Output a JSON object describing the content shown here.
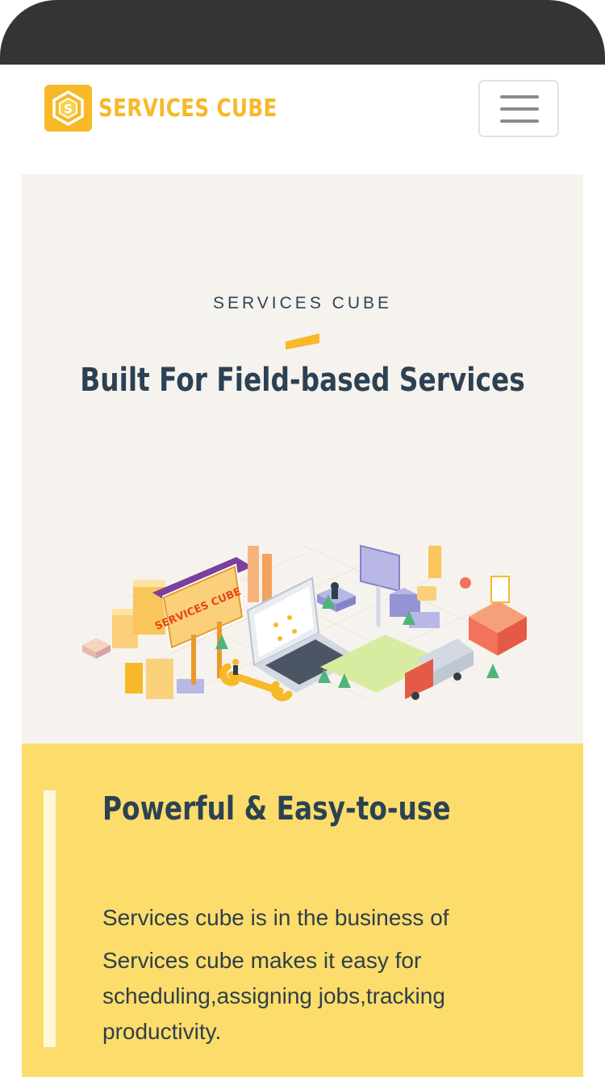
{
  "brand": {
    "name": "SERVICES CUBE",
    "logo_icon": "services-cube-logo",
    "accent_color": "#f7b928"
  },
  "nav": {
    "menu_icon": "hamburger-menu-icon"
  },
  "hero": {
    "eyebrow": "SERVICES CUBE",
    "title": "Built For Field-based Services",
    "illustration_sign": "SERVICES CUBE",
    "background": "#f6f3ee"
  },
  "feature": {
    "title": "Powerful & Easy-to-use",
    "paragraph_1": "Services cube is in the business of",
    "paragraph_2": "Services cube makes it easy for scheduling,assigning jobs,tracking productivity.",
    "background": "#fcdd6b"
  }
}
